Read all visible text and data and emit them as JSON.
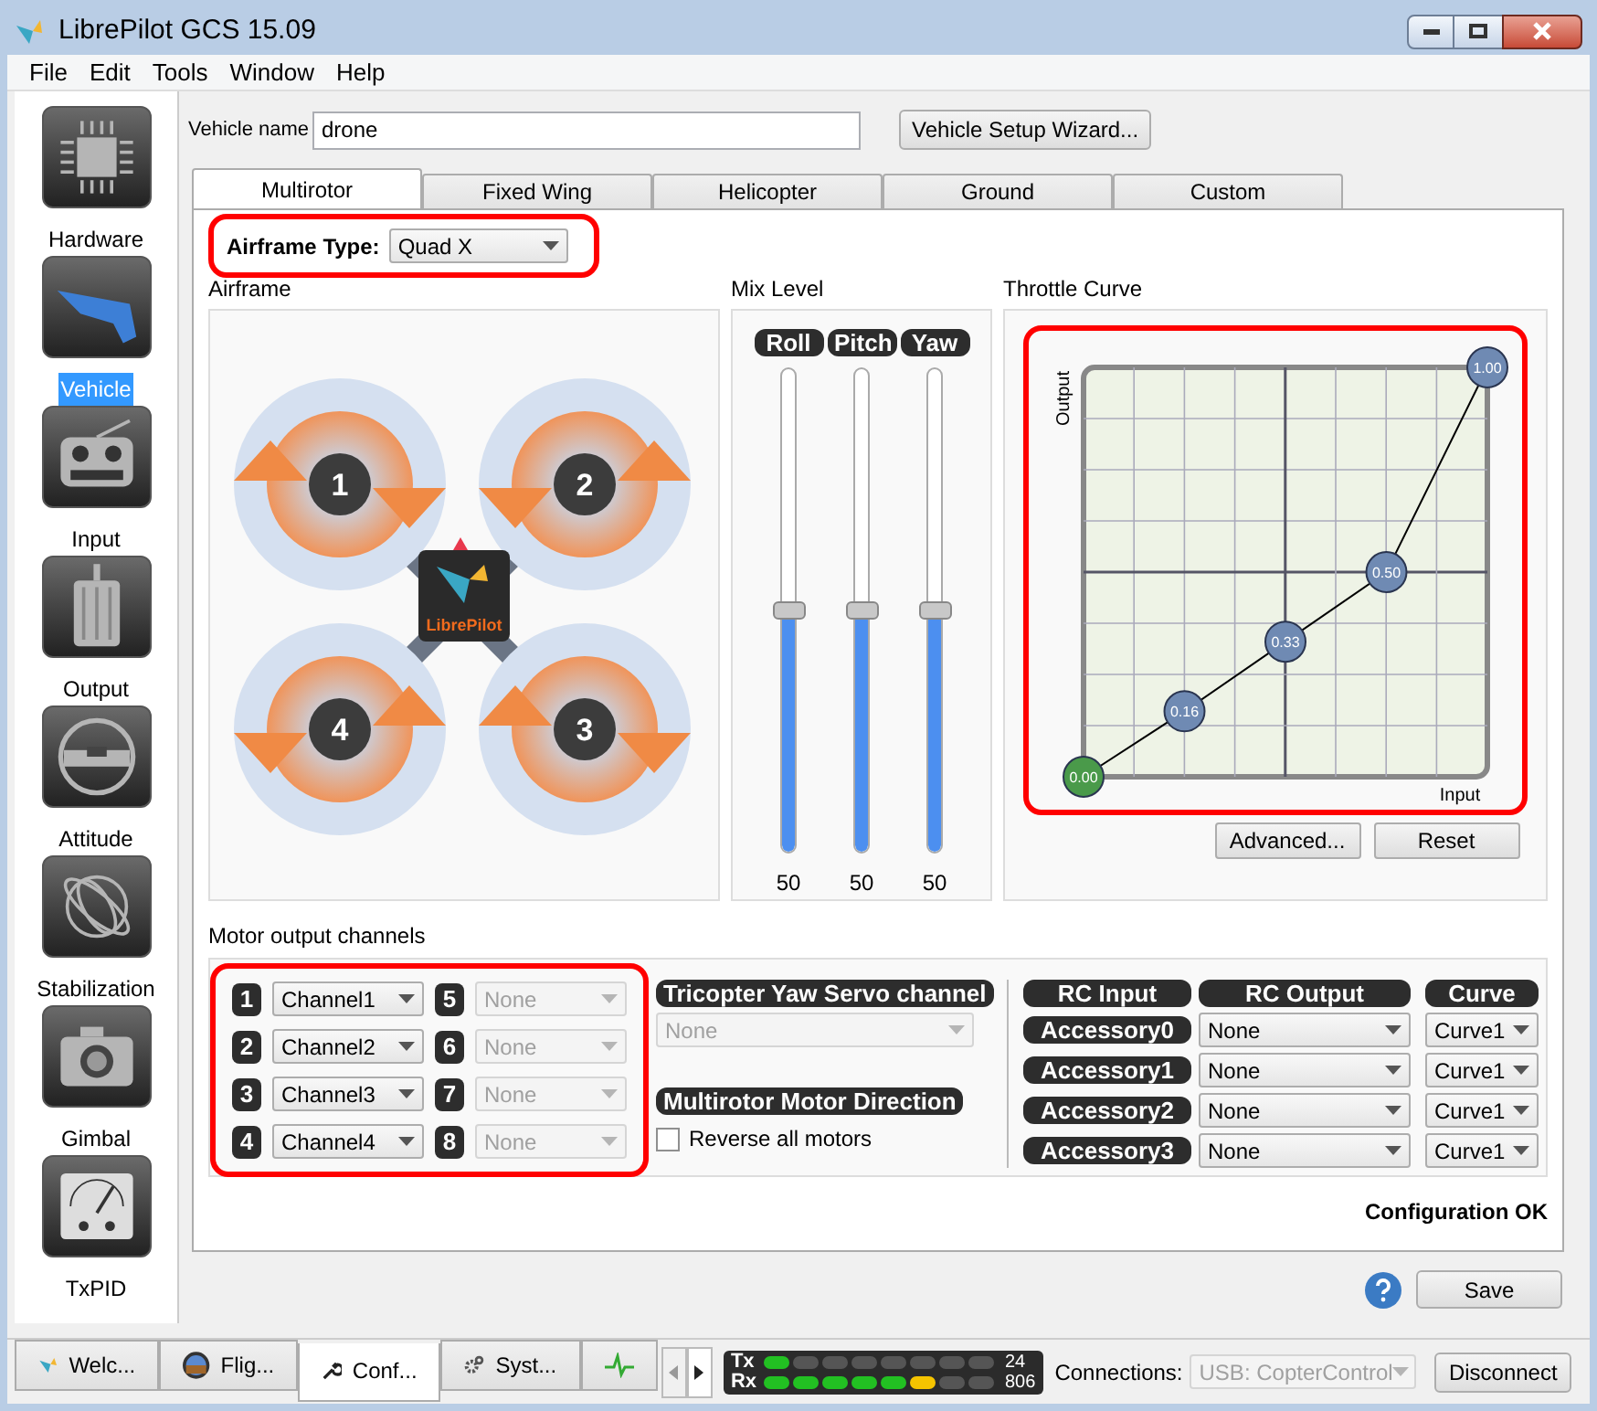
{
  "window": {
    "title": "LibrePilot GCS 15.09"
  },
  "menu": [
    "File",
    "Edit",
    "Tools",
    "Window",
    "Help"
  ],
  "sidebar": {
    "items": [
      {
        "label": "Hardware",
        "selected": false
      },
      {
        "label": "Vehicle",
        "selected": true
      },
      {
        "label": "Input",
        "selected": false
      },
      {
        "label": "Output",
        "selected": false
      },
      {
        "label": "Attitude",
        "selected": false
      },
      {
        "label": "Stabilization",
        "selected": false
      },
      {
        "label": "Gimbal",
        "selected": false
      },
      {
        "label": "TxPID",
        "selected": false
      }
    ]
  },
  "vehicle_name": {
    "label": "Vehicle name",
    "value": "drone"
  },
  "wizard_button": "Vehicle Setup Wizard...",
  "tabs": [
    {
      "label": "Multirotor",
      "selected": true
    },
    {
      "label": "Fixed Wing",
      "selected": false
    },
    {
      "label": "Helicopter",
      "selected": false
    },
    {
      "label": "Ground",
      "selected": false
    },
    {
      "label": "Custom",
      "selected": false
    }
  ],
  "airframe_type": {
    "label": "Airframe Type:",
    "value": "Quad X",
    "highlighted": true
  },
  "airframe": {
    "title": "Airframe",
    "motors": [
      "1",
      "2",
      "4",
      "3"
    ],
    "logo": "LibrePilot"
  },
  "mix_level": {
    "title": "Mix Level",
    "sliders": [
      {
        "label": "Roll",
        "level": 0.5,
        "reading": "50"
      },
      {
        "label": "Pitch",
        "level": 0.5,
        "reading": "50"
      },
      {
        "label": "Yaw",
        "level": 0.5,
        "reading": "50"
      }
    ]
  },
  "throttle_curve": {
    "title": "Throttle Curve",
    "highlighted": true,
    "input_label": "Input",
    "output_label": "Output",
    "points": [
      {
        "label": "0.00"
      },
      {
        "label": "0.16"
      },
      {
        "label": "0.33"
      },
      {
        "label": "0.50"
      },
      {
        "label": "1.00"
      }
    ],
    "buttons": [
      "Advanced...",
      "Reset"
    ]
  },
  "motor_output": {
    "title": "Motor output channels",
    "highlighted": true,
    "channels": [
      {
        "number": "1",
        "value": "Channel1",
        "disabled": false
      },
      {
        "number": "2",
        "value": "Channel2",
        "disabled": false
      },
      {
        "number": "3",
        "value": "Channel3",
        "disabled": false
      },
      {
        "number": "4",
        "value": "Channel4",
        "disabled": false
      },
      {
        "number": "5",
        "value": "None",
        "disabled": true
      },
      {
        "number": "6",
        "value": "None",
        "disabled": true
      },
      {
        "number": "7",
        "value": "None",
        "disabled": true
      },
      {
        "number": "8",
        "value": "None",
        "disabled": true
      }
    ]
  },
  "tricopter": {
    "title": "Tricopter Yaw Servo channel",
    "value": "None",
    "disabled": true
  },
  "motor_direction": {
    "title": "Multirotor Motor Direction",
    "checkbox": {
      "label": "Reverse all motors",
      "checked": false
    }
  },
  "accessories": {
    "columns": [
      "RC Input",
      "RC Output",
      "Curve"
    ],
    "rows": [
      {
        "input": "Accessory0",
        "output": "None",
        "curve": "Curve1"
      },
      {
        "input": "Accessory1",
        "output": "None",
        "curve": "Curve1"
      },
      {
        "input": "Accessory2",
        "output": "None",
        "curve": "Curve1"
      },
      {
        "input": "Accessory3",
        "output": "None",
        "curve": "Curve1"
      }
    ]
  },
  "status": "Configuration OK",
  "save_button": "Save",
  "bottom_tabs": [
    {
      "kind": "text",
      "label": "Welc...",
      "selected": false
    },
    {
      "kind": "text",
      "label": "Flig...",
      "selected": false
    },
    {
      "kind": "text",
      "label": "Conf...",
      "selected": true
    },
    {
      "kind": "text",
      "label": "Syst...",
      "selected": false
    },
    {
      "kind": "icon_only",
      "selected": false
    }
  ],
  "telemetry": [
    {
      "label": "Tx",
      "level": 0.125,
      "reading": "24"
    },
    {
      "label": "Rx",
      "level": 0.75,
      "reading": "806"
    }
  ],
  "connections": {
    "label": "Connections:",
    "value": "USB: CopterControl",
    "disabled": true
  },
  "disconnect_button": "Disconnect"
}
